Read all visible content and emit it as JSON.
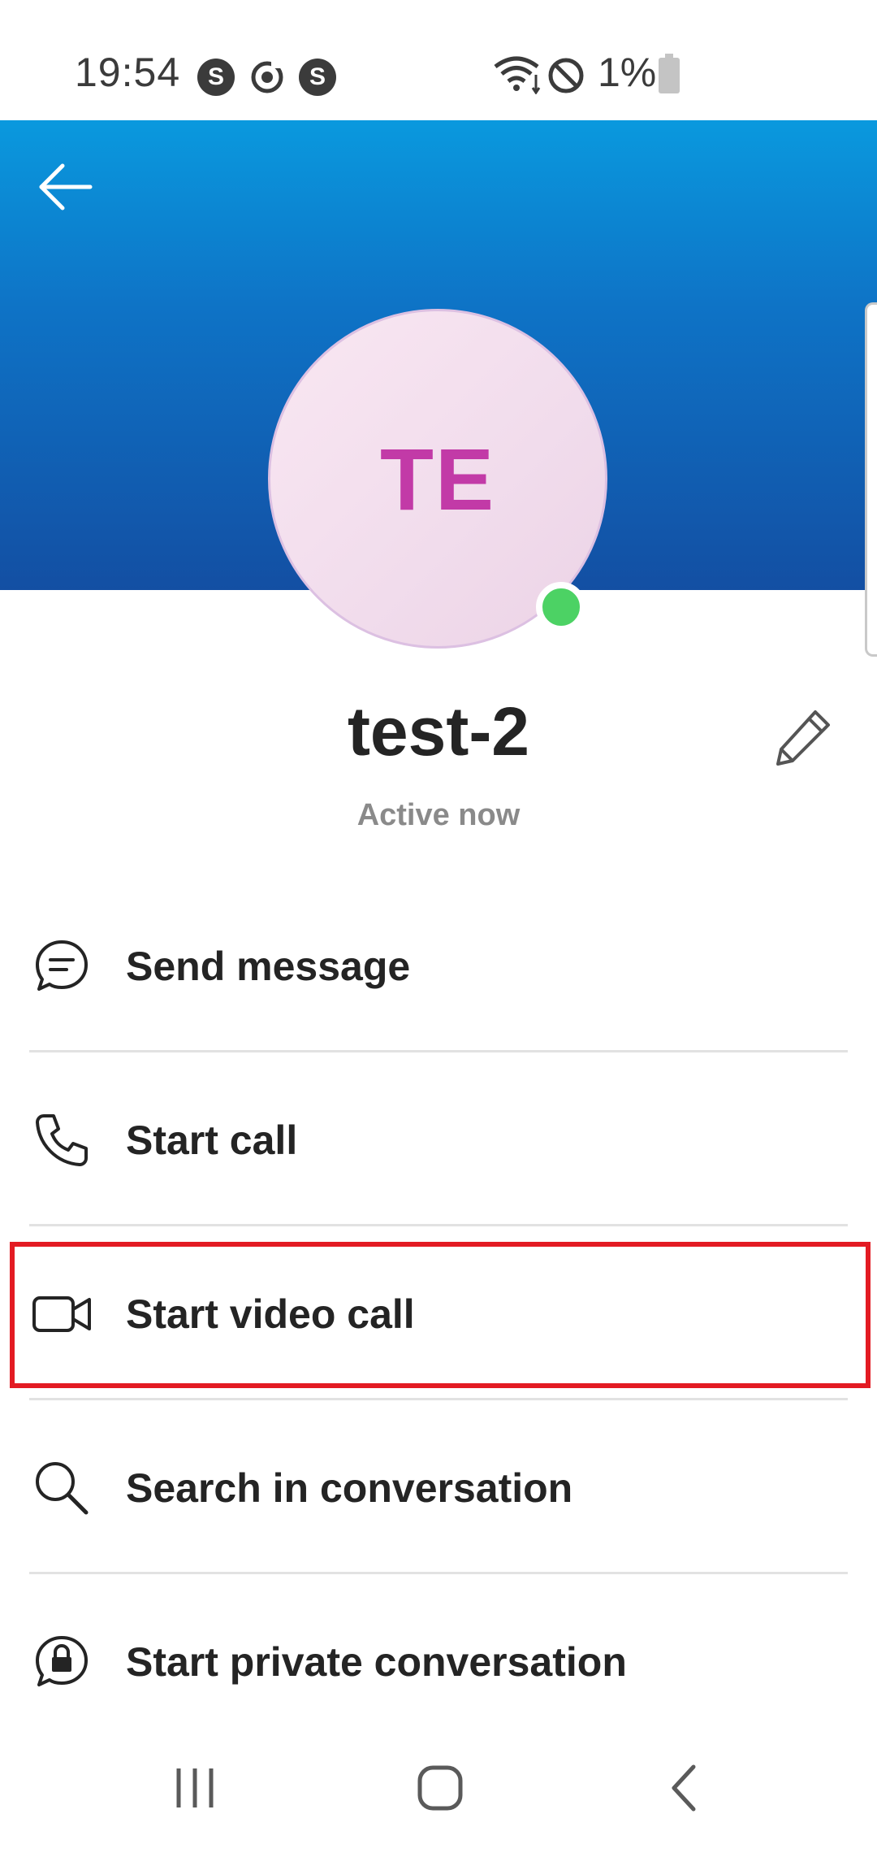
{
  "status_bar": {
    "time": "19:54",
    "app_icons": [
      "skype-icon",
      "sync-icon",
      "skype-icon"
    ],
    "battery_percent": "1%",
    "icons": [
      "wifi-icon",
      "do-not-disturb-icon",
      "battery-icon"
    ]
  },
  "header": {
    "back_icon": "back-arrow-icon",
    "gradient_top": "#0a99de",
    "gradient_bottom": "#134fa3"
  },
  "profile": {
    "initials": "TE",
    "name": "test-2",
    "status": "Active now",
    "presence_color": "#4cd264",
    "initials_color": "#c23aa7"
  },
  "menu": {
    "items": [
      {
        "label": "Send message",
        "icon": "chat-bubble-icon"
      },
      {
        "label": "Start call",
        "icon": "phone-icon"
      },
      {
        "label": "Start video call",
        "icon": "video-camera-icon",
        "highlighted": true
      },
      {
        "label": "Search in conversation",
        "icon": "search-icon"
      },
      {
        "label": "Start private conversation",
        "icon": "lock-chat-icon"
      }
    ]
  },
  "highlight_color": "#e31b23",
  "nav_bar": {
    "buttons": [
      "recent-apps-icon",
      "home-icon",
      "back-icon"
    ]
  }
}
